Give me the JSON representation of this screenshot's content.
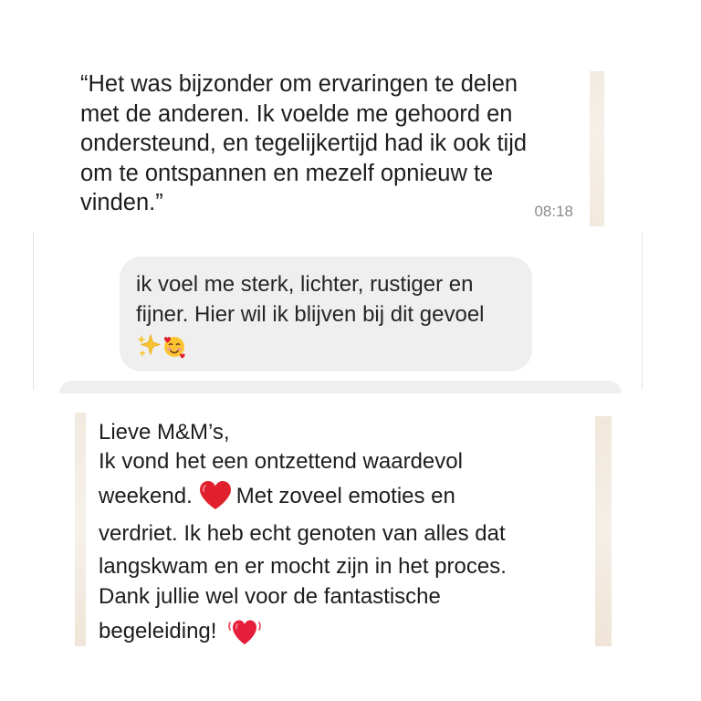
{
  "message_1": {
    "text": "“Het was bijzonder om ervaringen te delen\nmet de anderen. Ik voelde me gehoord en\nondersteund, en tegelijkertijd had ik ook tijd\nom te ontspannen en mezelf opnieuw te\nvinden.”",
    "time": "08:18"
  },
  "message_2": {
    "line_1": "ik voel me sterk, lichter, rustiger en",
    "line_2": "fijner. Hier wil ik blijven bij dit gevoel",
    "emojis": [
      "sparkles-icon",
      "smiling-face-with-hearts-icon"
    ]
  },
  "message_3": {
    "line_1": "Lieve M&M’s,",
    "line_2": "Ik vond het een ontzettend waardevol",
    "line_3_a": "weekend.",
    "line_3_b": "Met zoveel emoties en",
    "line_4": "verdriet. Ik heb echt genoten van alles dat",
    "line_5": "langskwam en er mocht zijn in het proces.",
    "line_6": "Dank jullie wel voor de fantastische",
    "line_7": "begeleiding!",
    "icons": [
      "red-heart-icon",
      "beating-heart-icon"
    ]
  },
  "colors": {
    "heart": "#e0202c",
    "instagram_bubble": "#efefef",
    "timestamp": "#8a8a8a",
    "wallpaper": "#efe6d9"
  }
}
